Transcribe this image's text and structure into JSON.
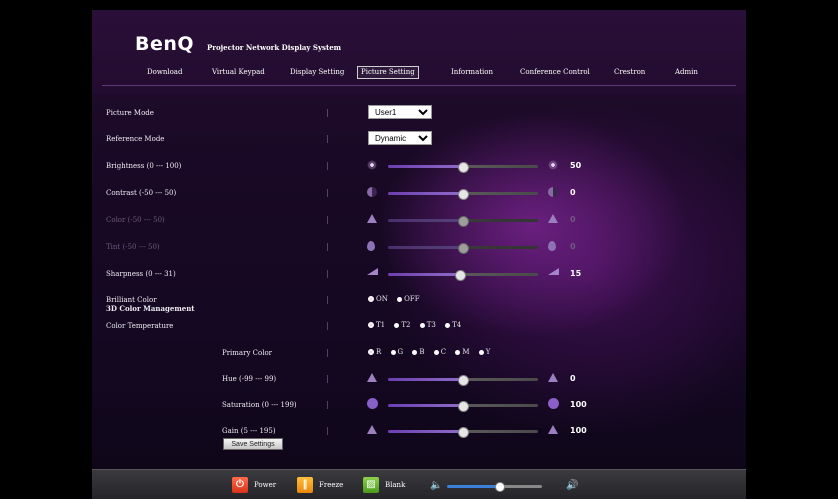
{
  "header": {
    "brand": "BenQ",
    "title": "Projector Network Display System"
  },
  "nav": [
    {
      "label": "Download"
    },
    {
      "label": "Virtual Keypad"
    },
    {
      "label": "Display Setting"
    },
    {
      "label": "Picture Setting",
      "active": true
    },
    {
      "label": "Information"
    },
    {
      "label": "Conference Control"
    },
    {
      "label": "Crestron"
    },
    {
      "label": "Admin"
    }
  ],
  "settings": {
    "picture_mode": {
      "label": "Picture Mode",
      "value": "User1"
    },
    "reference_mode": {
      "label": "Reference Mode",
      "value": "Dynamic"
    },
    "brightness": {
      "label": "Brightness (0 --- 100)",
      "value": "50",
      "level": 0.5
    },
    "contrast": {
      "label": "Contrast (-50 --- 50)",
      "value": "0",
      "level": 0.5
    },
    "color": {
      "label": "Color (-50 --- 50)",
      "value": "0",
      "level": 0.5,
      "disabled": true
    },
    "tint": {
      "label": "Tint (-50 --- 50)",
      "value": "0",
      "level": 0.5,
      "disabled": true
    },
    "sharpness": {
      "label": "Sharpness (0 --- 31)",
      "value": "15",
      "level": 0.48
    },
    "brilliant_color": {
      "label": "Brilliant Color",
      "options": [
        "ON",
        "OFF"
      ],
      "selected": "ON"
    },
    "color_temperature": {
      "label": "Color Temperature",
      "options": [
        "T1",
        "T2",
        "T3",
        "T4"
      ],
      "selected": "T1"
    }
  },
  "color_management": {
    "label": "3D Color Management",
    "primary_color": {
      "label": "Primary Color",
      "options": [
        "R",
        "G",
        "B",
        "C",
        "M",
        "Y"
      ],
      "selected": "R"
    },
    "hue": {
      "label": "Hue (-99 --- 99)",
      "value": "0",
      "level": 0.5
    },
    "saturation": {
      "label": "Saturation (0 --- 199)",
      "value": "100",
      "level": 0.5
    },
    "gain": {
      "label": "Gain (5 --- 195)",
      "value": "100",
      "level": 0.5
    },
    "save_label": "Save Settings"
  },
  "footer": {
    "power": "Power",
    "freeze": "Freeze",
    "blank": "Blank",
    "volume_level": 0.55
  },
  "colors": {
    "accent": "#8a5fc8",
    "volume": "#3b7fd9",
    "power": "#e0401f",
    "freeze": "#f0a020",
    "blank": "#6ab830"
  }
}
